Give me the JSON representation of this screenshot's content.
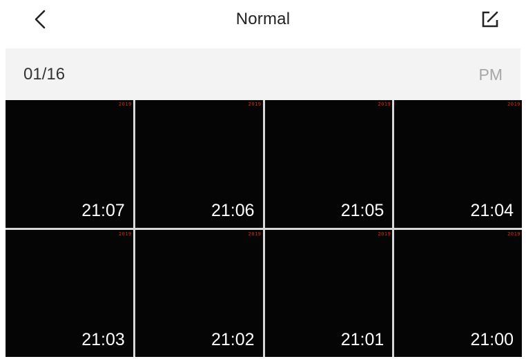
{
  "header": {
    "title": "Normal",
    "back_icon": "chevron-left-icon",
    "edit_icon": "edit-icon"
  },
  "date_section": {
    "date": "01/16",
    "period": "PM"
  },
  "thumbnails": [
    {
      "stamp": "2019",
      "time": "21:07"
    },
    {
      "stamp": "2019",
      "time": "21:06"
    },
    {
      "stamp": "2019",
      "time": "21:05"
    },
    {
      "stamp": "2019",
      "time": "21:04"
    },
    {
      "stamp": "2019",
      "time": "21:03"
    },
    {
      "stamp": "2019",
      "time": "21:02"
    },
    {
      "stamp": "2019",
      "time": "21:01"
    },
    {
      "stamp": "2019",
      "time": "21:00"
    }
  ],
  "colors": {
    "thumbnail_bg": "#050505",
    "stamp_text": "#b33a22",
    "date_bar_bg": "#f3f3f3"
  }
}
